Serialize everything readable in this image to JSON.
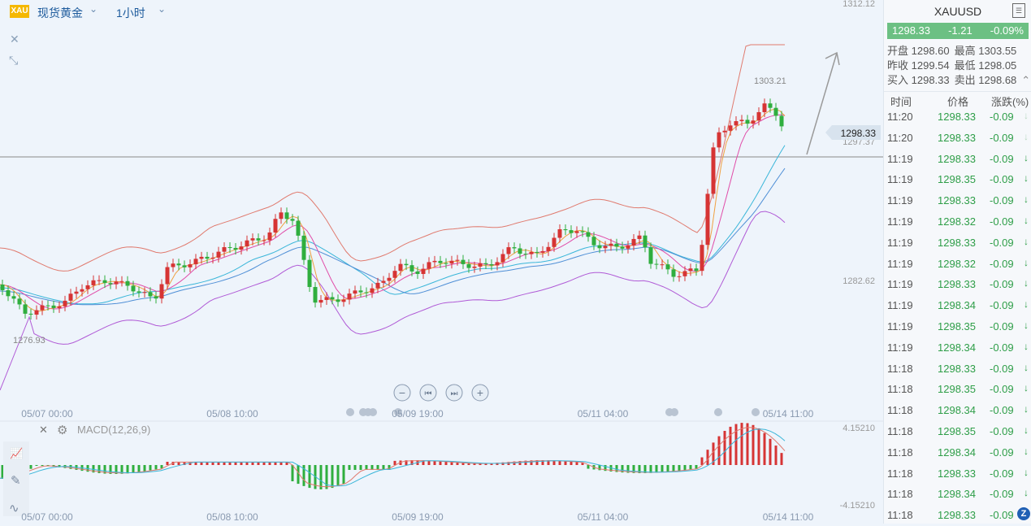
{
  "header": {
    "badge": "XAU",
    "symbol_name": "现货黄金",
    "period": "1小时"
  },
  "chart": {
    "price_axis": {
      "top": "1312.12",
      "mid_high": "1297.37",
      "mid_low": "1282.62"
    },
    "current_price_tag": "1298.33",
    "high_marker": "1303.21",
    "low_marker": "1276.93",
    "date_labels": [
      "05/07 00:00",
      "05/08 10:00",
      "05/09 19:00",
      "05/11 04:00",
      "05/14 11:00"
    ],
    "macd_label": "MACD(12,26,9)",
    "macd_axis": {
      "top": "4.15210",
      "bottom": "-4.15210"
    },
    "colors": {
      "up": "#d63434",
      "down": "#2fae3e",
      "upper_band": "#e07a6e",
      "lower_band": "#b05ad6",
      "ma_pink": "#e04ca8",
      "ma_orange": "#f0a040",
      "ma_cyan": "#3ab6d9",
      "ma_blue": "#4f8fd6"
    }
  },
  "panel": {
    "title": "XAUUSD",
    "last": "1298.33",
    "change": "-1.21",
    "change_pct": "-0.09%",
    "open_label": "开盘",
    "open": "1298.60",
    "high_label": "最高",
    "high": "1303.55",
    "prev_label": "昨收",
    "prev": "1299.54",
    "low_label": "最低",
    "low": "1298.05",
    "bid_label": "买入",
    "bid": "1298.33",
    "ask_label": "卖出",
    "ask": "1298.68",
    "col_time": "时间",
    "col_price": "价格",
    "col_change": "涨跌(%)",
    "ticks": [
      {
        "time": "11:20",
        "price": "1298.33",
        "chg": "-0.09",
        "arrow": "↓"
      },
      {
        "time": "11:20",
        "price": "1298.33",
        "chg": "-0.09",
        "arrow": "↓"
      },
      {
        "time": "11:19",
        "price": "1298.33",
        "chg": "-0.09",
        "arrow": "↓"
      },
      {
        "time": "11:19",
        "price": "1298.35",
        "chg": "-0.09",
        "arrow": "↓"
      },
      {
        "time": "11:19",
        "price": "1298.33",
        "chg": "-0.09",
        "arrow": "↓"
      },
      {
        "time": "11:19",
        "price": "1298.32",
        "chg": "-0.09",
        "arrow": "↓"
      },
      {
        "time": "11:19",
        "price": "1298.33",
        "chg": "-0.09",
        "arrow": "↓"
      },
      {
        "time": "11:19",
        "price": "1298.32",
        "chg": "-0.09",
        "arrow": "↓"
      },
      {
        "time": "11:19",
        "price": "1298.33",
        "chg": "-0.09",
        "arrow": "↓"
      },
      {
        "time": "11:19",
        "price": "1298.34",
        "chg": "-0.09",
        "arrow": "↓"
      },
      {
        "time": "11:19",
        "price": "1298.35",
        "chg": "-0.09",
        "arrow": "↓"
      },
      {
        "time": "11:19",
        "price": "1298.34",
        "chg": "-0.09",
        "arrow": "↓"
      },
      {
        "time": "11:18",
        "price": "1298.33",
        "chg": "-0.09",
        "arrow": "↓"
      },
      {
        "time": "11:18",
        "price": "1298.35",
        "chg": "-0.09",
        "arrow": "↓"
      },
      {
        "time": "11:18",
        "price": "1298.34",
        "chg": "-0.09",
        "arrow": "↓"
      },
      {
        "time": "11:18",
        "price": "1298.35",
        "chg": "-0.09",
        "arrow": "↓"
      },
      {
        "time": "11:18",
        "price": "1298.34",
        "chg": "-0.09",
        "arrow": "↓"
      },
      {
        "time": "11:18",
        "price": "1298.33",
        "chg": "-0.09",
        "arrow": "↓"
      },
      {
        "time": "11:18",
        "price": "1298.34",
        "chg": "-0.09",
        "arrow": "↓"
      },
      {
        "time": "11:18",
        "price": "1298.33",
        "chg": "-0.09",
        "arrow": "↓"
      }
    ]
  }
}
